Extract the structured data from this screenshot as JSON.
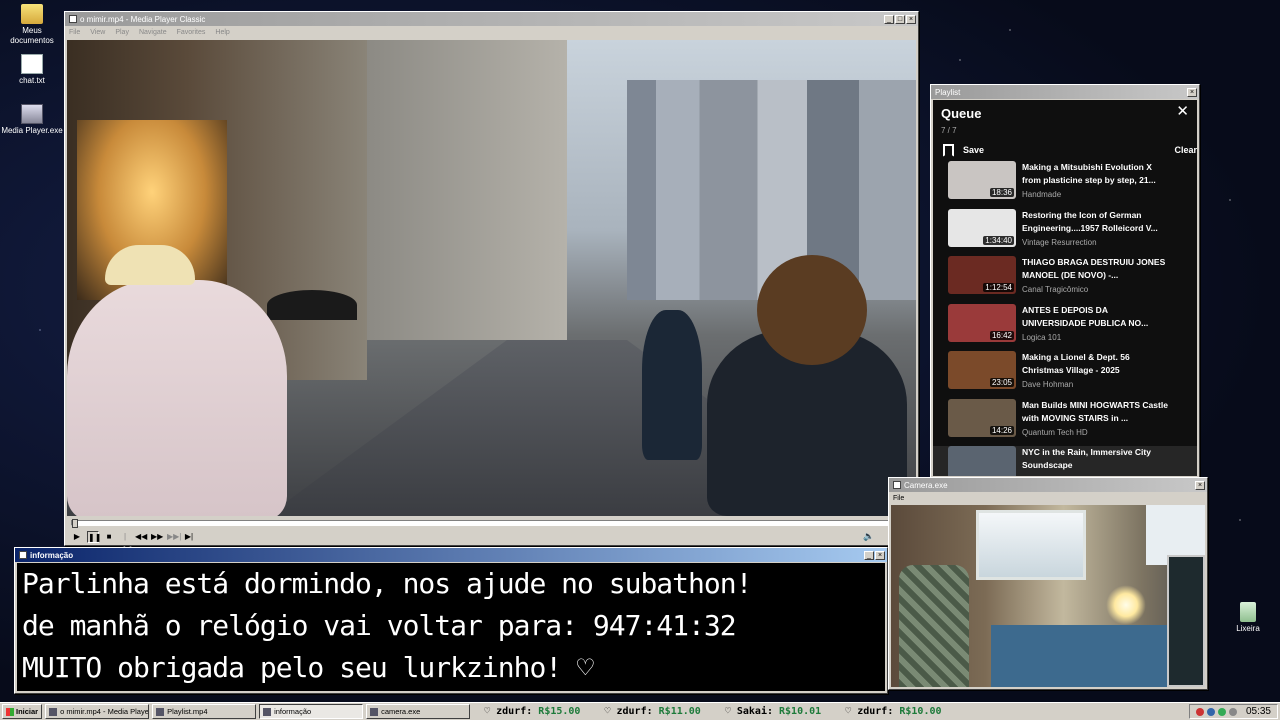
{
  "desktop": {
    "icons": [
      {
        "label": "Meus documentos",
        "icon": "folder-icon"
      },
      {
        "label": "chat.txt",
        "icon": "text-file-icon"
      },
      {
        "label": "Media Player.exe",
        "icon": "executable-icon"
      },
      {
        "label": "Lixeira",
        "icon": "recycle-bin-icon"
      }
    ]
  },
  "player": {
    "title": "o mimir.mp4 - Media Player Classic",
    "menu": [
      "File",
      "View",
      "Play",
      "Navigate",
      "Favorites",
      "Help"
    ],
    "progress": 0.0
  },
  "playlist_window": {
    "title": "Playlist",
    "heading": "Queue",
    "count": "7 / 7",
    "save_label": "Save",
    "clear_label": "Clear",
    "items": [
      {
        "title": "Making a Mitsubishi Evolution X from plasticine step by step, 21...",
        "channel": "Handmade",
        "duration": "18:36",
        "thumb_color": "#c9c5c2"
      },
      {
        "title": "Restoring the Icon of German Engineering....1957 Rolleicord V...",
        "channel": "Vintage Resurrection",
        "duration": "1:34:40",
        "thumb_color": "#e6e6e6"
      },
      {
        "title": "THIAGO BRAGA DESTRUIU JONES MANOEL (DE NOVO) -...",
        "channel": "Canal Tragicômico",
        "duration": "1:12:54",
        "thumb_color": "#6b2a22"
      },
      {
        "title": "ANTES E DEPOIS DA UNIVERSIDADE PUBLICA NO...",
        "channel": "Logica 101",
        "duration": "16:42",
        "thumb_color": "#9a3a3a"
      },
      {
        "title": "Making a Lionel & Dept. 56 Christmas Village - 2025",
        "channel": "Dave Hohman",
        "duration": "23:05",
        "thumb_color": "#7b4a2a"
      },
      {
        "title": "Man Builds MINI HOGWARTS Castle with MOVING STAIRS in ...",
        "channel": "Quantum Tech HD",
        "duration": "14:26",
        "thumb_color": "#6a5a48"
      },
      {
        "title": "NYC in the Rain, Immersive City Soundscape",
        "channel": "",
        "duration": "",
        "thumb_color": "#5a6470"
      }
    ]
  },
  "info_window": {
    "title": "informação",
    "lines": [
      "Parlinha está dormindo, nos ajude no subathon!",
      "de manhã o relógio vai voltar para:  947:41:32",
      "MUITO obrigada pelo seu lurkzinho! ♡"
    ]
  },
  "camera_window": {
    "title": "Camera.exe",
    "menu": [
      "File"
    ]
  },
  "taskbar": {
    "start_label": "Iniciar",
    "tasks": [
      {
        "label": "o mimir.mp4 - Media Player...",
        "active": false
      },
      {
        "label": "Playlist.mp4",
        "active": false
      },
      {
        "label": "informação",
        "active": true
      },
      {
        "label": "camera.exe",
        "active": false
      }
    ],
    "ticker": [
      {
        "user": "zdurf:",
        "value": "R$15.00"
      },
      {
        "user": "zdurf:",
        "value": "R$11.00"
      },
      {
        "user": "Sakai:",
        "value": "R$10.01"
      },
      {
        "user": "zdurf:",
        "value": "R$10.00"
      }
    ],
    "clock": "05:35"
  }
}
